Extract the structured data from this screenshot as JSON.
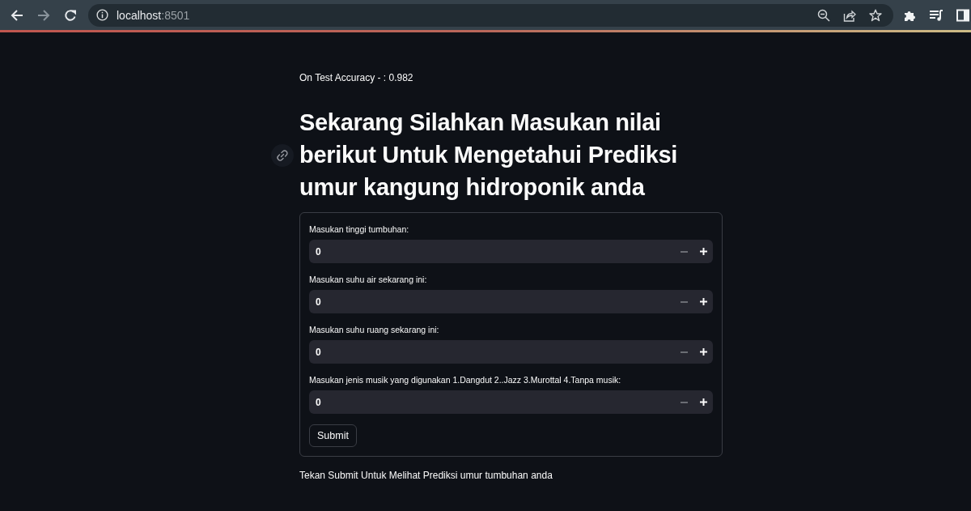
{
  "browser": {
    "nav": [
      {
        "kind": "back",
        "disabled": false
      },
      {
        "kind": "forward",
        "disabled": true
      },
      {
        "kind": "reload",
        "disabled": false
      }
    ],
    "url": {
      "host": "localhost",
      "port": ":8501"
    }
  },
  "page": {
    "accuracy_text": "On Test Accuracy - : 0.982",
    "heading": "Sekarang Silahkan Masukan nilai berikut Untuk Mengetahui Prediksi umur kangung hidroponik anda"
  },
  "form": {
    "fields": [
      {
        "label": "Masukan tinggi tumbuhan:",
        "value": "0",
        "decrement_disabled": true
      },
      {
        "label": "Masukan suhu air sekarang ini:",
        "value": "0",
        "decrement_disabled": true
      },
      {
        "label": "Masukan suhu ruang sekarang ini:",
        "value": "0",
        "decrement_disabled": true
      },
      {
        "label": "Masukan jenis musik yang digunakan 1.Dangdut 2..Jazz 3.Murottal 4.Tanpa musik:",
        "value": "0",
        "decrement_disabled": true
      }
    ],
    "submit_button": "Submit"
  },
  "footer_text": "Tekan Submit Untuk Melihat Prediksi umur tumbuhan anda"
}
